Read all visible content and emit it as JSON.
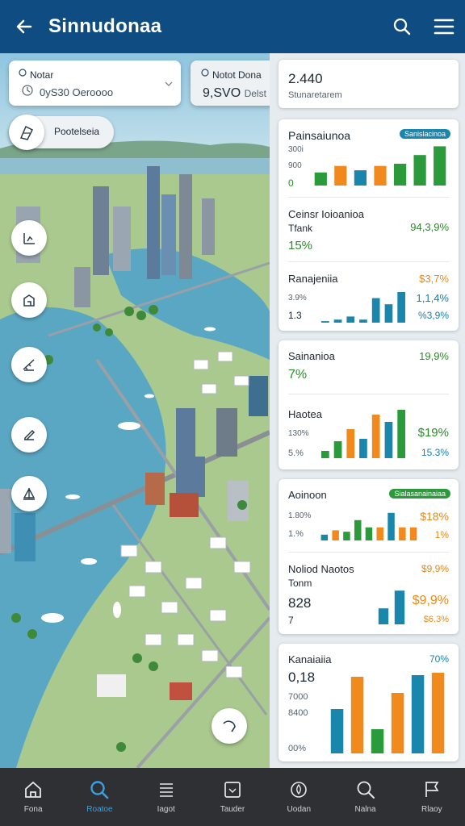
{
  "app": {
    "title": "Sinnudonaa"
  },
  "icons": {
    "back": "arrow-left-icon",
    "search": "search-icon",
    "menu": "hamburger-icon"
  },
  "map": {
    "filter_primary": {
      "label": "Notar",
      "value": "0yS30 Oeroooo"
    },
    "filter_secondary": {
      "label": "Notot Dona",
      "value": "9,SVO",
      "suffix": "Delst"
    },
    "layer_chip": {
      "label": "Pootelseia"
    },
    "tools": [
      "crop-icon",
      "chart-line-icon",
      "building-icon",
      "ruler-icon",
      "draw-icon",
      "sail-icon"
    ]
  },
  "panel": {
    "summary": {
      "value": "2.440",
      "caption": "Stunaretarem"
    },
    "card1": {
      "sec1": {
        "title": "Painsaiunoa",
        "badge": "Sanislacinoa",
        "axis_top": "300i",
        "axis_mid": "900",
        "axis_bot": "0"
      },
      "sec2": {
        "title": "Ceinsr Ioioanioa",
        "sub": "Tfank",
        "value": "15%",
        "right": "94,3,9%"
      },
      "sec3": {
        "title": "Ranajeniia",
        "small1": "3.9%",
        "small2": "1.3",
        "right1": "$3,7%",
        "right2": "1,1,4%",
        "right3": "%3,9%"
      }
    },
    "card2": {
      "sec1": {
        "title": "Sainanioa",
        "value": "7%",
        "right": "19,9%"
      },
      "sec2": {
        "title": "Haotea",
        "small1": "130%",
        "small2": "5.%",
        "right1": "$19%",
        "right2": "15.3%"
      }
    },
    "card3": {
      "sec1": {
        "title": "Aoinoon",
        "badge": "Sialasanainaiaa",
        "small1": "1.80%",
        "small2": "1.%",
        "right1": "$18%",
        "right2": "1%"
      },
      "sec2": {
        "title": "Noliod Naotos",
        "sub": "Tonm",
        "value": "828",
        "small": "7",
        "right1": "$9,9%",
        "right2": "$9,9%",
        "right3": "$6.3%"
      }
    },
    "card4": {
      "title": "Kanaiaiia",
      "value": "0,18",
      "small1": "7000",
      "small2": "8400",
      "small3": "00%",
      "right": "70%"
    },
    "colors": {
      "green": "#2a9a3a",
      "orange": "#f08a1c",
      "blue": "#1b86ac"
    }
  },
  "chart_data": [
    {
      "type": "bar",
      "title": "Painsaiunoa",
      "values": [
        0.3,
        0.45,
        0.35,
        0.45,
        0.5,
        0.7,
        0.9
      ]
    },
    {
      "type": "bar",
      "title": "Ranajeniia",
      "values": [
        0.05,
        0.1,
        0.2,
        0.1,
        0.8,
        0.6,
        1.0
      ]
    },
    {
      "type": "bar",
      "title": "Haotea",
      "values": [
        0.15,
        0.35,
        0.6,
        0.4,
        0.9,
        0.75,
        1.0
      ]
    },
    {
      "type": "bar",
      "title": "Aoinoon",
      "values": [
        0.2,
        0.35,
        0.3,
        0.7,
        0.45,
        0.45,
        0.95,
        0.45,
        0.45
      ]
    },
    {
      "type": "bar",
      "title": "Noliod Naotos",
      "values": [
        0.45,
        0.95
      ]
    },
    {
      "type": "bar",
      "title": "Kanaiaiia",
      "values": [
        0.55,
        0.95,
        0.3,
        0.75,
        0.97,
        1.0
      ]
    }
  ],
  "bottom_nav": [
    {
      "label": "Fona",
      "icon": "home-icon",
      "active": false
    },
    {
      "label": "Roatoe",
      "icon": "search-icon",
      "active": true
    },
    {
      "label": "Iagot",
      "icon": "list-icon",
      "active": false
    },
    {
      "label": "Tauder",
      "icon": "frame-icon",
      "active": false
    },
    {
      "label": "Uodan",
      "icon": "fire-icon",
      "active": false
    },
    {
      "label": "Nalna",
      "icon": "search-icon",
      "active": false
    },
    {
      "label": "Rlaoy",
      "icon": "flag-icon",
      "active": false
    }
  ]
}
